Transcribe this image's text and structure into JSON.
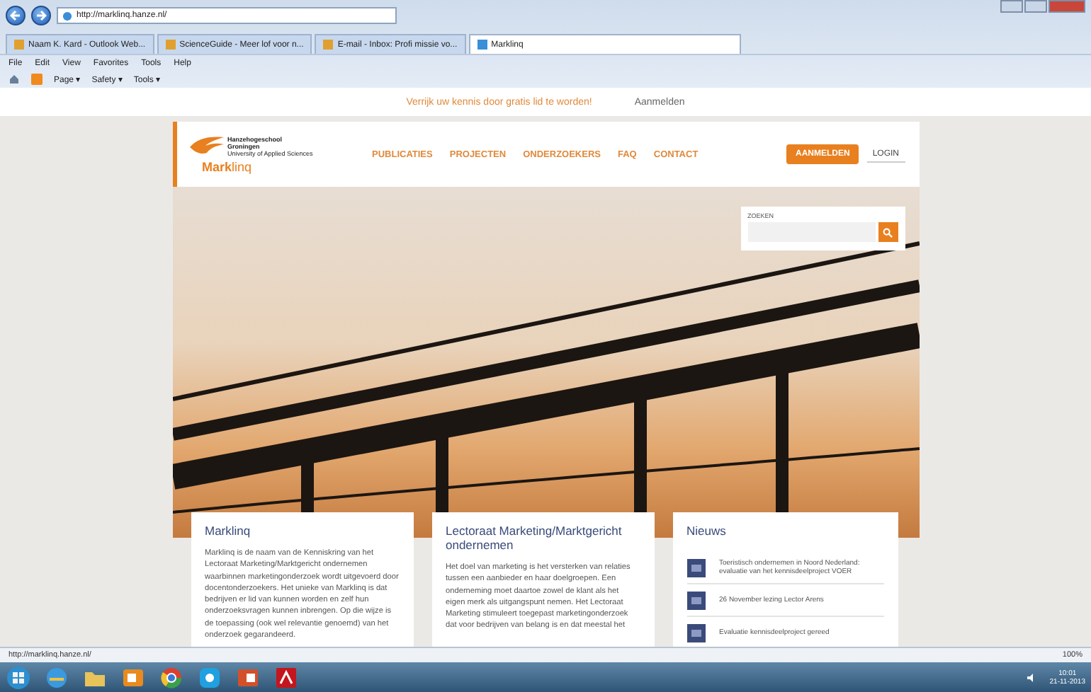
{
  "browser": {
    "url": "http://marklinq.hanze.nl/",
    "tabs": [
      {
        "label": "Naam K. Kard - Outlook Web...",
        "selected": false
      },
      {
        "label": "ScienceGuide - Meer lof voor n...",
        "selected": false
      },
      {
        "label": "E-mail - Inbox: Profi missie vo...",
        "selected": false
      },
      {
        "label": "Marklinq",
        "selected": true
      }
    ],
    "menu": [
      "File",
      "Edit",
      "View",
      "Favorites",
      "Tools",
      "Help"
    ],
    "command_bar": [
      "Page ▾",
      "Safety ▾",
      "Tools ▾"
    ]
  },
  "top_strip": {
    "message": "Verrijk uw kennis door gratis lid te worden!",
    "link": "Aanmelden"
  },
  "logo": {
    "line_1": "Hanzehogeschool",
    "line_2": "Groningen",
    "line_3": "University of Applied Sciences",
    "site_name": "**Mark**linq"
  },
  "nav": [
    "PUBLICATIES",
    "PROJECTEN",
    "ONDERZOEKERS",
    "FAQ",
    "CONTACT"
  ],
  "signup_button": "AANMELDEN",
  "login_link": "LOGIN",
  "search": {
    "label": "ZOEKEN"
  },
  "cards": [
    {
      "title": "Marklinq",
      "body": "Marklinq is de naam van de Kenniskring van het Lectoraat Marketing/Marktgericht ondernemen waarbinnen marketingonderzoek wordt uitgevoerd door docentonderzoekers. Het unieke van Marklinq is dat bedrijven er lid van kunnen worden en zelf hun onderzoeksvragen kunnen inbrengen. Op die wijze is de toepassing (ook wel relevantie genoemd) van het onderzoek gegarandeerd."
    },
    {
      "title": "Lectoraat Marketing/Marktgericht ondernemen",
      "body": "Het doel van marketing is het versterken van relaties tussen een aanbieder en haar doelgroepen. Een onderneming moet daartoe zowel de klant als het eigen merk als uitgangspunt nemen. Het Lectoraat Marketing stimuleert toegepast marketingonderzoek dat voor bedrijven van belang is en dat meestal het"
    }
  ],
  "news": {
    "title": "Nieuws",
    "items": [
      "Toeristisch ondernemen in Noord Nederland: evaluatie van het kennisdeelproject VOER",
      "26 November lezing Lector Arens",
      "Evaluatie kennisdeelproject gereed"
    ]
  },
  "status_bar": {
    "url": "http://marklinq.hanze.nl/",
    "zoom": "100%"
  },
  "taskbar": {
    "time": "10:01",
    "date": "21-11-2013"
  }
}
